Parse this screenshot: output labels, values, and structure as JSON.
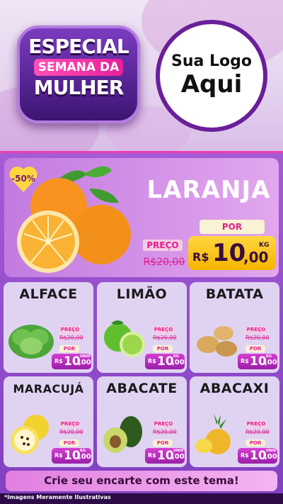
{
  "header": {
    "badge": {
      "line1": "ESPECIAL",
      "line2": "SEMANA DA",
      "line3": "MULHER"
    },
    "logo": {
      "line1": "Sua Logo",
      "line2": "Aqui"
    }
  },
  "featured": {
    "discount": "-50%",
    "name": "LARANJA",
    "price_label": "PREÇO",
    "old_price": "R$20,00",
    "por_label": "POR",
    "currency": "R$",
    "price_int": "10",
    "price_dec": ",00",
    "unit": "KG"
  },
  "products": [
    {
      "name": "ALFACE",
      "price_label": "PREÇO",
      "old_price": "R$20,00",
      "por_label": "POR",
      "currency": "R$",
      "price_int": "10",
      "price_dec": ",00",
      "unit": "UNID"
    },
    {
      "name": "LIMÃO",
      "price_label": "PREÇO",
      "old_price": "R$20,00",
      "por_label": "POR",
      "currency": "R$",
      "price_int": "10",
      "price_dec": ",00",
      "unit": "KG"
    },
    {
      "name": "BATATA",
      "price_label": "PREÇO",
      "old_price": "R$20,00",
      "por_label": "POR",
      "currency": "R$",
      "price_int": "10",
      "price_dec": ",00",
      "unit": "KG"
    },
    {
      "name": "MARACUJÁ",
      "price_label": "PREÇO",
      "old_price": "R$20,00",
      "por_label": "POR",
      "currency": "R$",
      "price_int": "10",
      "price_dec": ",00",
      "unit": "KG"
    },
    {
      "name": "ABACATE",
      "price_label": "PREÇO",
      "old_price": "R$20,00",
      "por_label": "POR",
      "currency": "R$",
      "price_int": "10",
      "price_dec": ",00",
      "unit": "UNID"
    },
    {
      "name": "ABACAXI",
      "price_label": "PREÇO",
      "old_price": "R$20,00",
      "por_label": "POR",
      "currency": "R$",
      "price_int": "10",
      "price_dec": ",00",
      "unit": "UNID"
    }
  ],
  "cta": "Crie seu encarte com este tema!",
  "footer_note": "*Imagens Meramente Ilustrativas",
  "colors": {
    "purple": "#8040c0",
    "pink": "#e0208d",
    "yellow": "#ffd640",
    "magenta": "#c02fc0"
  }
}
